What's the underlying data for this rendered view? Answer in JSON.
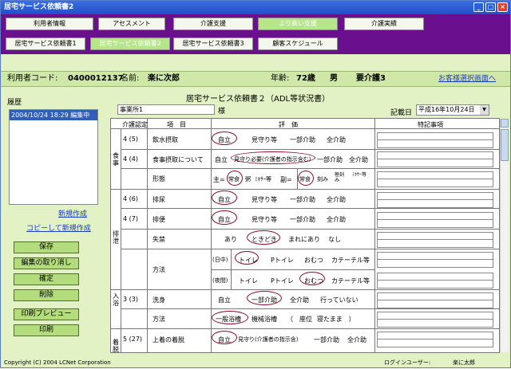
{
  "window": {
    "title": "居宅サービス依頼書2"
  },
  "nav": {
    "tabs": [
      "利用者情報",
      "アセスメント",
      "介護支援",
      "より高い支援",
      "介護実績"
    ],
    "active": 3
  },
  "subnav": {
    "tabs": [
      "居宅サービス依頼書1",
      "居宅サービス依頼書2",
      "居宅サービス依頼書3",
      "顧客スケジュール"
    ],
    "active": 1
  },
  "user": {
    "code_label": "利用者コード:",
    "code": "0400012137",
    "name_label": "名前:",
    "name": "楽に次郎",
    "age_label": "年齢:",
    "age": "72歳",
    "gender": "男",
    "care_level": "要介護3",
    "back_link": "お客様選択画面へ"
  },
  "left": {
    "history_label": "履歴",
    "history_item": "2004/10/24 18:29 編集中",
    "new_link": "新規作成",
    "copy_link": "コピーして新規作成",
    "buttons": [
      "保存",
      "編集の取り消し",
      "確定",
      "削除",
      "印刷プレビュー",
      "印刷"
    ]
  },
  "form": {
    "office": "事業所1",
    "sama": "様",
    "title": "居宅サービス依頼書２（ADL等状況書）",
    "date_label": "記載日",
    "date": "平成16年10月24日",
    "headers": {
      "level": "介護認定",
      "item": "項　目",
      "eval": "評　価",
      "notes": "特記事項"
    },
    "groups": {
      "meal": "食事",
      "excretion": "排泄",
      "bath": "入浴",
      "dress": "着脱"
    },
    "rows": {
      "r1": {
        "level": "4 (5)",
        "item": "飲水摂取",
        "opts": [
          "自立",
          "見守り等",
          "一部介助",
          "全介助"
        ]
      },
      "r2": {
        "level": "4 (4)",
        "item": "食事摂取について",
        "opts": [
          "自立",
          "見守り必要(介護者の指示含む)",
          "一部介助",
          "全介助"
        ]
      },
      "r3": {
        "item": "形態",
        "main": "主=",
        "main_opts": [
          "常食",
          "粥",
          "ﾐｷｻｰ等"
        ],
        "side": "副=",
        "side_opts": [
          "常食",
          "刻み",
          "極刻み",
          "ﾐｷｻｰ等"
        ]
      },
      "r4": {
        "level": "4 (6)",
        "item": "排尿",
        "opts": [
          "自立",
          "見守り等",
          "一部介助",
          "全介助"
        ]
      },
      "r5": {
        "level": "4 (7)",
        "item": "排便",
        "opts": [
          "自立",
          "見守り等",
          "一部介助",
          "全介助"
        ]
      },
      "r6": {
        "item": "失禁",
        "opts": [
          "あり",
          "ときどき",
          "まれにあり",
          "なし"
        ]
      },
      "r7": {
        "item": "方法",
        "day": "(日中)",
        "night": "(夜間)",
        "opts": [
          "トイレ",
          "Pトイレ",
          "おむつ",
          "カテーテル等"
        ]
      },
      "r8": {
        "level": "3 (3)",
        "item": "洗身",
        "opts": [
          "自立",
          "一部介助",
          "全介助",
          "行っていない"
        ]
      },
      "r9": {
        "item": "方法",
        "opts": [
          "一般浴槽",
          "機械浴槽",
          "（　座位",
          "寝たまま　）"
        ]
      },
      "r10": {
        "level": "5 (27)",
        "item": "上着の着脱",
        "opts": [
          "自立",
          "見守り(介護者の指示含)",
          "一部介助",
          "全介助"
        ]
      }
    }
  },
  "footer": {
    "copyright": "Copyright (C) 2004 LCNet Corporation",
    "login_label": "ログインユーザー:",
    "login_user": "楽に太郎"
  }
}
